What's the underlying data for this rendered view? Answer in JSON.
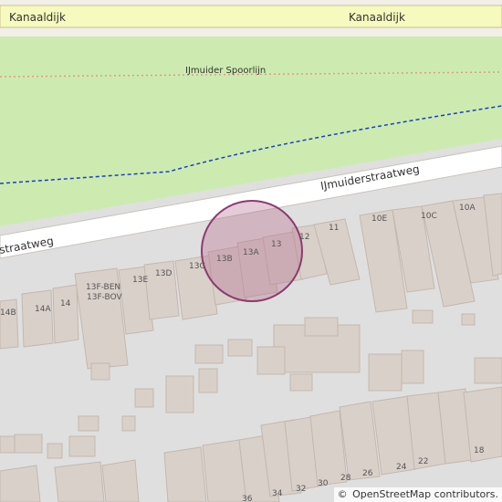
{
  "map": {
    "roads": {
      "kanaaldijk_left": "Kanaaldijk",
      "kanaaldijk_right": "Kanaaldijk",
      "ijmuiderstraatweg_upper": "IJmuiderstraatweg",
      "ijmuiderstraatweg_lower": "straatweg"
    },
    "railway": "IJmuider Spoorlijn",
    "house_numbers": [
      "14B",
      "14A",
      "14",
      "13F-BEN",
      "13F-BOV",
      "13E",
      "13D",
      "13C",
      "13B",
      "13A",
      "13",
      "12",
      "11",
      "10E",
      "10C",
      "10A",
      "13F-BEN",
      "13F-BOV",
      "36",
      "34",
      "32",
      "30",
      "28",
      "26",
      "24",
      "22",
      "18"
    ],
    "house_labels": {
      "n14b": "14B",
      "n14a": "14A",
      "n14": "14",
      "n13fben": "13F-BEN",
      "n13fbov": "13F-BOV",
      "n13e": "13E",
      "n13d": "13D",
      "n13c": "13C",
      "n13b": "13B",
      "n13a": "13A",
      "n13": "13",
      "n12": "12",
      "n11": "11",
      "n10e": "10E",
      "n10c": "10C",
      "n10a": "10A",
      "n36": "36",
      "n34": "34",
      "n32": "32",
      "n30": "30",
      "n28": "28",
      "n26": "26",
      "n24": "24",
      "n22": "22",
      "n18": "18"
    },
    "marker_color": "#b4698c",
    "colors": {
      "grass": "#cdebb0",
      "road_yellow": "#f7fabf",
      "building": "#d9d0c9",
      "background": "#e0dfdf",
      "railway_dash": "#1a3fc8"
    }
  },
  "attribution": {
    "symbol": "©",
    "text": "OpenStreetMap contributors."
  }
}
